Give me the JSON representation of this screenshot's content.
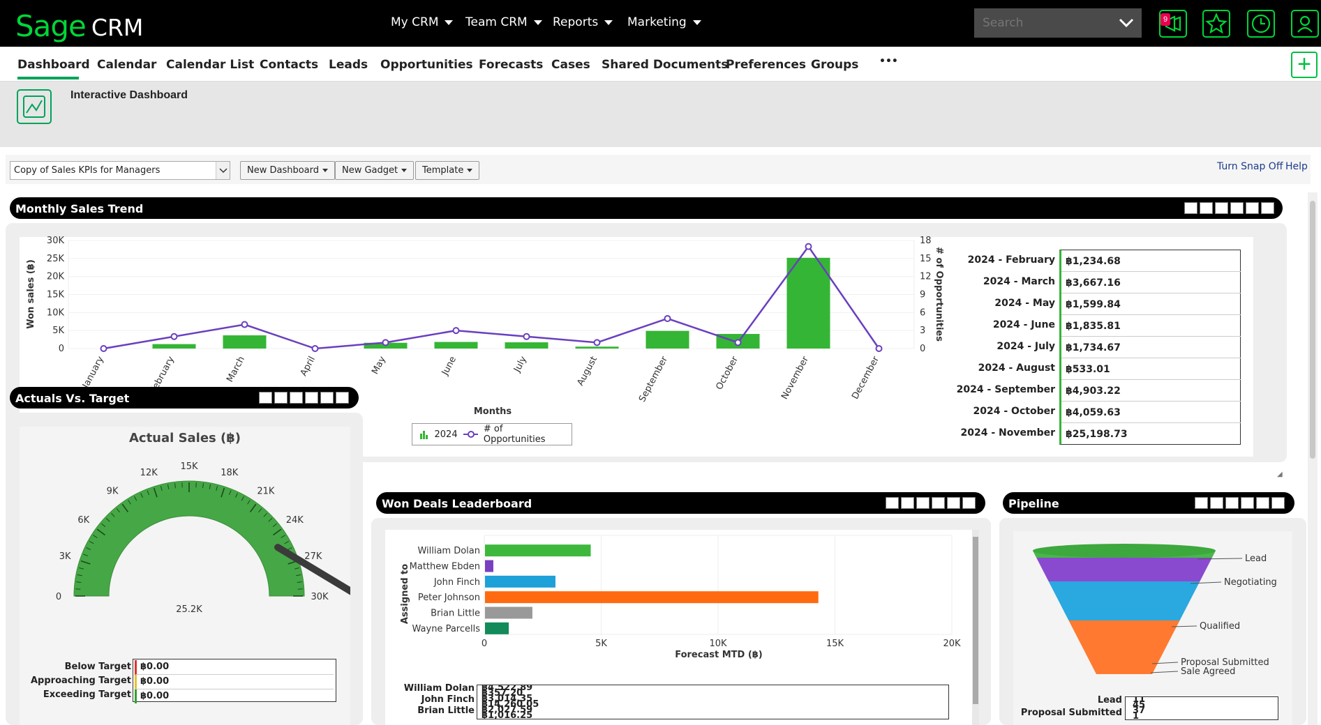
{
  "brand": {
    "sage": "Sage",
    "crm": "CRM"
  },
  "top_nav": [
    "My CRM",
    "Team CRM",
    "Reports",
    "Marketing"
  ],
  "search": {
    "placeholder": "Search"
  },
  "notification_count": "9",
  "tabs": [
    "Dashboard",
    "Calendar",
    "Calendar List",
    "Contacts",
    "Leads",
    "Opportunities",
    "Forecasts",
    "Cases",
    "Shared Documents",
    "Preferences",
    "Groups",
    "•••"
  ],
  "header": {
    "title": "Interactive Dashboard"
  },
  "toolbar": {
    "dashboard_select": "Copy of Sales KPIs for Managers",
    "new_dashboard": "New Dashboard",
    "new_gadget": "New Gadget",
    "template": "Template",
    "snap": "Turn Snap Off",
    "help": "Help"
  },
  "colors": {
    "accent": "#00d639",
    "bar": "#35b535",
    "line": "#6a3fbf"
  },
  "monthly": {
    "title": "Monthly Sales Trend",
    "table": [
      {
        "label": "2024 - February",
        "value": "฿1,234.68"
      },
      {
        "label": "2024 - March",
        "value": "฿3,667.16"
      },
      {
        "label": "2024 - May",
        "value": "฿1,599.84"
      },
      {
        "label": "2024 - June",
        "value": "฿1,835.81"
      },
      {
        "label": "2024 - July",
        "value": "฿1,734.67"
      },
      {
        "label": "2024 - August",
        "value": "฿533.01"
      },
      {
        "label": "2024 - September",
        "value": "฿4,903.22"
      },
      {
        "label": "2024 - October",
        "value": "฿4,059.63"
      },
      {
        "label": "2024 - November",
        "value": "฿25,198.73"
      }
    ]
  },
  "actuals": {
    "title": "Actuals Vs. Target",
    "gauge_title": "Actual Sales (฿)",
    "table": [
      {
        "label": "Below Target",
        "value": "฿0.00",
        "color": "#e03030"
      },
      {
        "label": "Approaching Target",
        "value": "฿0.00",
        "color": "#e8c030"
      },
      {
        "label": "Exceeding Target",
        "value": "฿0.00",
        "color": "#30a030"
      }
    ]
  },
  "leaderboard": {
    "title": "Won Deals Leaderboard",
    "bottom_names": [
      "William Dolan",
      "John Finch",
      "Brian Little"
    ],
    "bottom_values": [
      "฿4,522.89",
      "฿357.20",
      "฿3,014.35",
      "฿14,260.05",
      "฿2,027.59",
      "฿1,016.25"
    ]
  },
  "pipeline": {
    "title": "Pipeline",
    "labels": [
      "Lead",
      "Negotiating",
      "Qualified",
      "Proposal Submitted",
      "Sale Agreed"
    ],
    "bottom_labels": [
      "Lead",
      "Proposal Submitted"
    ],
    "bottom_values": [
      "11",
      "45",
      "37",
      "1"
    ]
  },
  "chart_data": [
    {
      "type": "bar",
      "title": "",
      "xlabel": "Months",
      "ylabel": "Won sales (฿)",
      "y2label": "# of Opportunities",
      "categories": [
        "January",
        "February",
        "March",
        "April",
        "May",
        "June",
        "July",
        "August",
        "September",
        "October",
        "November",
        "December"
      ],
      "series": [
        {
          "name": "2024",
          "type": "bar",
          "values": [
            0,
            1234.68,
            3667.16,
            0,
            1599.84,
            1835.81,
            1734.67,
            533.01,
            4903.22,
            4059.63,
            25198.73,
            0
          ]
        },
        {
          "name": "# of Opportunities",
          "type": "line",
          "axis": "right",
          "values": [
            0,
            2,
            4,
            0,
            1,
            3,
            2,
            1,
            5,
            1,
            17,
            0
          ]
        }
      ],
      "ylim": [
        0,
        30000
      ],
      "y2lim": [
        0,
        18
      ],
      "yticks": [
        "0",
        "5K",
        "10K",
        "15K",
        "20K",
        "25K",
        "30K"
      ],
      "y2ticks": [
        "0",
        "3",
        "6",
        "9",
        "12",
        "15",
        "18"
      ],
      "legend": "bottom"
    },
    {
      "type": "gauge",
      "title": "Actual Sales (฿)",
      "value": 25200,
      "value_label": "25.2K",
      "min": 0,
      "max": 30000,
      "ticks": [
        "0",
        "3K",
        "6K",
        "9K",
        "12K",
        "15K",
        "18K",
        "21K",
        "24K",
        "27K",
        "30K"
      ]
    },
    {
      "type": "bar",
      "orientation": "horizontal",
      "title": "",
      "xlabel": "Forecast MTD (฿)",
      "ylabel": "Assigned to",
      "categories": [
        "William Dolan",
        "Matthew Ebden",
        "John Finch",
        "Peter Johnson",
        "Brian Little",
        "Wayne Parcells"
      ],
      "values": [
        4522.89,
        357.2,
        3014.35,
        14260.05,
        2027.59,
        1016.25
      ],
      "colors": [
        "#3db83d",
        "#7a3fc0",
        "#1ea0d8",
        "#ff6a10",
        "#999999",
        "#128a5a"
      ],
      "xlim": [
        0,
        20000
      ],
      "xticks": [
        "0",
        "5K",
        "10K",
        "15K",
        "20K"
      ]
    },
    {
      "type": "funnel",
      "title": "",
      "categories": [
        "Lead",
        "Negotiating",
        "Qualified",
        "Proposal Submitted",
        "Sale Agreed"
      ],
      "colors": [
        "#3db83d",
        "#7a3fc0",
        "#1ea0d8",
        "#ff7a30",
        "#ff7a30"
      ]
    }
  ]
}
